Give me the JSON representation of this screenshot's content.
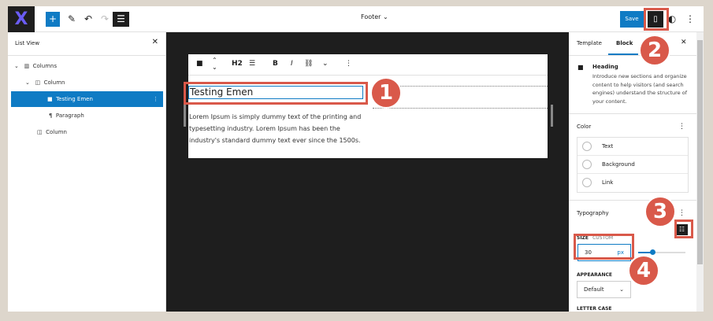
{
  "topbar": {
    "title": "Footer",
    "save_label": "Save",
    "logo_text": "X"
  },
  "list_view": {
    "title": "List View",
    "items": [
      {
        "label": "Columns",
        "icon": "columns-icon"
      },
      {
        "label": "Column",
        "icon": "column-icon"
      },
      {
        "label": "Testing Emen",
        "icon": "bookmark-icon",
        "selected": true
      },
      {
        "label": "Paragraph",
        "icon": "paragraph-icon"
      },
      {
        "label": "Column",
        "icon": "column-icon"
      }
    ]
  },
  "block_toolbar": {
    "heading_level": "H2",
    "bold": "B",
    "italic": "I"
  },
  "canvas": {
    "heading": "Testing Emen",
    "paragraph": "Lorem Ipsum is simply dummy text of the printing and typesetting industry. Lorem Ipsum has been the industry's standard dummy text ever since the 1500s."
  },
  "sidebar": {
    "tabs": [
      "Template",
      "Block"
    ],
    "active_tab": "Block",
    "block_name": "Heading",
    "block_desc": "Introduce new sections and organize content to help visitors (and search engines) understand the structure of your content.",
    "color_title": "Color",
    "color_options": [
      "Text",
      "Background",
      "Link"
    ],
    "typography_title": "Typography",
    "size_label": "SIZE",
    "size_mode": "CUSTOM",
    "size_value": "30",
    "size_unit": "px",
    "appearance_label": "APPEARANCE",
    "appearance_value": "Default",
    "letter_case_label": "LETTER CASE"
  },
  "annotations": [
    "1",
    "2",
    "3",
    "4"
  ],
  "colors": {
    "accent": "#0f7bc4",
    "annotation": "#d9594a",
    "canvas": "#1e1e1e"
  }
}
